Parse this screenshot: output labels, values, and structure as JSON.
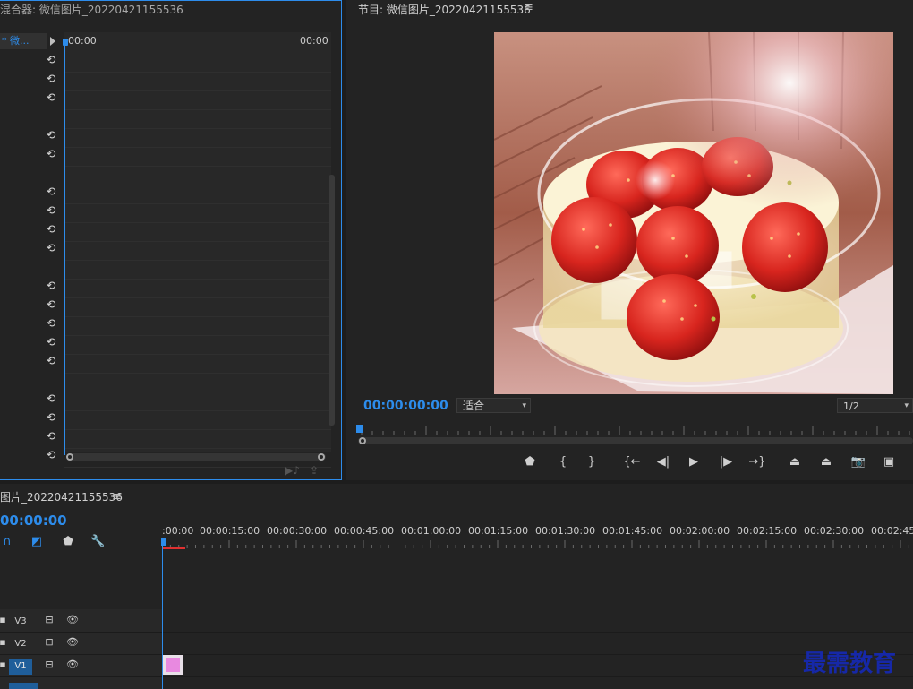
{
  "left_panel": {
    "title": "混合器: 微信图片_20220421155536",
    "clip_tab": "* 微...",
    "time_start": "00:00",
    "time_end": "00:00",
    "reset_icon_name": "reset-icon"
  },
  "program_monitor": {
    "title": "节目: 微信图片_20220421155536",
    "menu_icon": "≡",
    "timecode": "00:00:00:00",
    "fit_value": "适合",
    "resolution_value": "1/2",
    "transport": [
      {
        "name": "add-marker-button",
        "glyph": "⬟"
      },
      {
        "name": "mark-in-button",
        "glyph": "{"
      },
      {
        "name": "mark-out-button",
        "glyph": "}"
      },
      {
        "name": "go-to-in-button",
        "glyph": "{←"
      },
      {
        "name": "step-back-button",
        "glyph": "◀|"
      },
      {
        "name": "play-button",
        "glyph": "▶"
      },
      {
        "name": "step-forward-button",
        "glyph": "|▶"
      },
      {
        "name": "go-to-out-button",
        "glyph": "→}"
      },
      {
        "name": "lift-button",
        "glyph": "⏏"
      },
      {
        "name": "extract-button",
        "glyph": "⏏"
      },
      {
        "name": "export-frame-button",
        "glyph": "📷"
      },
      {
        "name": "compare-button",
        "glyph": "▣"
      }
    ]
  },
  "timeline": {
    "title": "图片_20220421155536",
    "menu_icon": "≡",
    "timecode": "00:00:00",
    "ruler_labels": [
      ":00:00",
      "00:00:15:00",
      "00:00:30:00",
      "00:00:45:00",
      "00:01:00:00",
      "00:01:15:00",
      "00:01:30:00",
      "00:01:45:00",
      "00:02:00:00",
      "00:02:15:00",
      "00:02:30:00",
      "00:02:45"
    ],
    "tracks": [
      {
        "label": "V3",
        "active": false
      },
      {
        "label": "V2",
        "active": false
      },
      {
        "label": "V1",
        "active": true
      }
    ]
  },
  "watermark": "最需教育",
  "colors": {
    "accent": "#2d8ceb",
    "panel_bg": "#232323",
    "clip_color": "#e889e0"
  }
}
